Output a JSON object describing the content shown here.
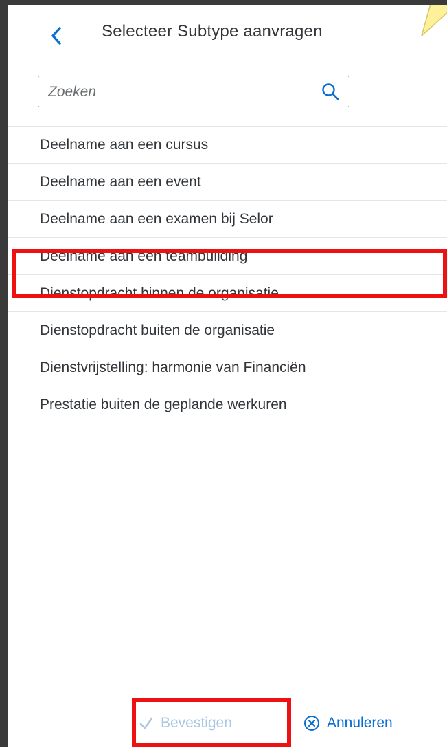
{
  "header": {
    "title": "Selecteer Subtype aanvragen",
    "back_icon": "chevron-left-icon"
  },
  "search": {
    "placeholder": "Zoeken",
    "value": "",
    "icon": "search-icon"
  },
  "list": {
    "items": [
      {
        "label": "Deelname aan een cursus"
      },
      {
        "label": "Deelname aan een event"
      },
      {
        "label": "Deelname aan een examen bij Selor"
      },
      {
        "label": "Deelname aan een teambuilding",
        "highlighted": true
      },
      {
        "label": "Dienstopdracht binnen de organisatie"
      },
      {
        "label": "Dienstopdracht buiten de organisatie"
      },
      {
        "label": "Dienstvrijstelling: harmonie van Financiën"
      },
      {
        "label": "Prestatie buiten de geplande werkuren"
      }
    ]
  },
  "footer": {
    "confirm_label": "Bevestigen",
    "confirm_icon": "checkmark-icon",
    "confirm_enabled": false,
    "cancel_label": "Annuleren",
    "cancel_icon": "circle-x-icon"
  },
  "colors": {
    "accent": "#0a6ed1",
    "disabled_accent": "#a9c6e3",
    "highlight": "#ee1111",
    "sticky_note": "#fff19a",
    "text": "#32363a",
    "divider": "#e5e5e5"
  }
}
